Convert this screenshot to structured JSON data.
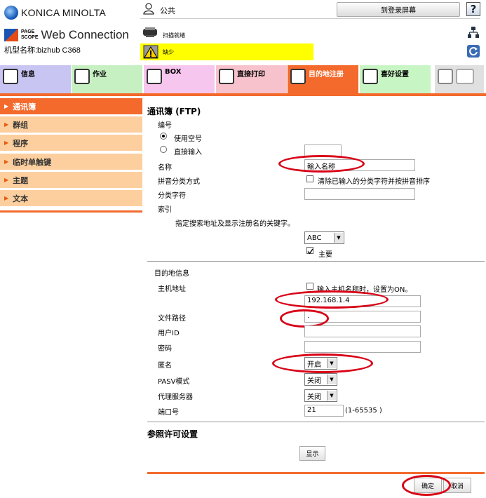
{
  "header": {
    "brand": "KONICA MINOLTA",
    "pagescope_line1": "PAGE",
    "pagescope_line2": "SCOPE",
    "product": "Web Connection",
    "model_label": "机型名称:bizhub C368",
    "user": "公共",
    "top_button": "到登录屏幕",
    "help": "?",
    "status_printer": "扫描就绪",
    "status_warning": "缺少"
  },
  "tabs": [
    {
      "label": "信息",
      "bg": "#c9c5f2"
    },
    {
      "label": "作业",
      "bg": "#c7f0c2"
    },
    {
      "label": "BOX",
      "bg": "#f7c6ef"
    },
    {
      "label": "直接打印",
      "bg": "#f7c2cc"
    },
    {
      "label": "目的地注册",
      "bg": "#f36a2c"
    },
    {
      "label": "喜好设置",
      "bg": "#c8f5c4"
    }
  ],
  "sidebar": [
    {
      "label": "通讯簿",
      "active": true
    },
    {
      "label": "群组"
    },
    {
      "label": "程序"
    },
    {
      "label": "临时单触键"
    },
    {
      "label": "主题"
    },
    {
      "label": "文本"
    }
  ],
  "form": {
    "title": "通讯簿 (FTP)",
    "number_label": "编号",
    "radio_use_free": "使用空号",
    "radio_direct": "直接输入",
    "name_label": "名称",
    "name_value": "輸入名称",
    "pinyin_label": "拼音分类方式",
    "pinyin_check": "清除已输入的分类字符并按拼音排序",
    "sortchar_label": "分类字符",
    "index_label": "索引",
    "index_hint": "指定搜索地址及显示注册名的关键字。",
    "index_value": "ABC",
    "main_check": "主要",
    "dest_section": "目的地信息",
    "host_label": "主机地址",
    "host_check": "输入主机名称时，设置为ON。",
    "host_value": "192.168.1.4",
    "path_label": "文件路径",
    "path_value": ".",
    "userid_label": "用户ID",
    "password_label": "密码",
    "anon_label": "匿名",
    "anon_value": "开启",
    "pasv_label": "PASV模式",
    "pasv_value": "关闭",
    "proxy_label": "代理服务器",
    "proxy_value": "关闭",
    "port_label": "端口号",
    "port_value": "21",
    "port_range": "(1-65535 )",
    "perm_title": "参照许可设置",
    "show_button": "显示",
    "ok_button": "确定",
    "cancel_button": "取消"
  },
  "colors": {
    "accent": "#f36a2c",
    "sidebar": "#fdcf9f",
    "highlight": "#d80016",
    "warning": "#ffff00"
  }
}
